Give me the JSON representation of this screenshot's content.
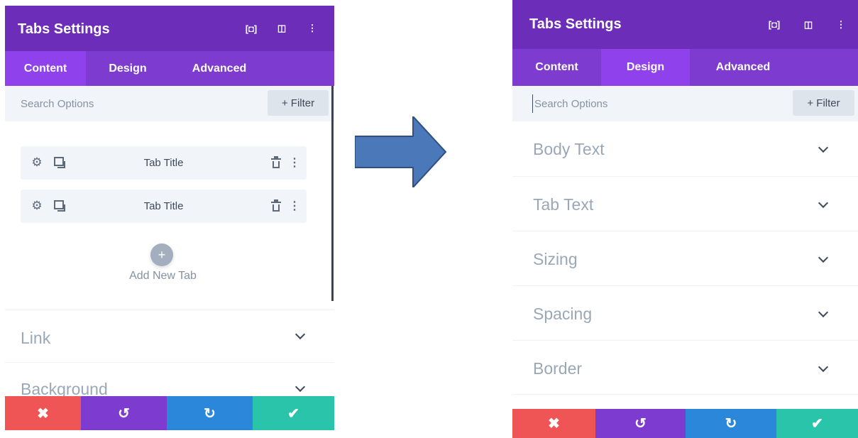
{
  "left": {
    "header": {
      "title": "Tabs Settings",
      "icons": [
        "fullscreen-icon",
        "split-view-icon",
        "more-options-icon"
      ]
    },
    "tabs": [
      {
        "label": "Content",
        "active": true
      },
      {
        "label": "Design",
        "active": false
      },
      {
        "label": "Advanced",
        "active": false
      }
    ],
    "search": {
      "placeholder": "Search Options",
      "filter_label": "+ Filter"
    },
    "tab_items": [
      {
        "title": "Tab Title"
      },
      {
        "title": "Tab Title"
      }
    ],
    "add_new_label": "Add New Tab",
    "sections": [
      {
        "label": "Link"
      },
      {
        "label": "Background"
      }
    ]
  },
  "right": {
    "header": {
      "title": "Tabs Settings",
      "icons": [
        "fullscreen-icon",
        "split-view-icon",
        "more-options-icon"
      ]
    },
    "tabs": [
      {
        "label": "Content",
        "active": false
      },
      {
        "label": "Design",
        "active": true
      },
      {
        "label": "Advanced",
        "active": false
      }
    ],
    "search": {
      "placeholder": "Search Options",
      "filter_label": "+ Filter"
    },
    "sections": [
      {
        "label": "Body Text"
      },
      {
        "label": "Tab Text"
      },
      {
        "label": "Sizing"
      },
      {
        "label": "Spacing"
      },
      {
        "label": "Border"
      }
    ]
  },
  "footer": {
    "buttons": [
      {
        "icon": "close-icon",
        "glyph": "✖",
        "color": "#ef5555"
      },
      {
        "icon": "undo-icon",
        "glyph": "↺",
        "color": "#7e3bd0"
      },
      {
        "icon": "redo-icon",
        "glyph": "↻",
        "color": "#2b87da"
      },
      {
        "icon": "save-check-icon",
        "glyph": "✔",
        "color": "#29c4a9"
      }
    ]
  },
  "colors": {
    "header_bg": "#6c2eb9",
    "tabs_bg": "#7e3bd0",
    "active_tab_bg": "#8f42ec",
    "arrow_fill": "#4a78b8",
    "arrow_stroke": "#2e4f80"
  }
}
